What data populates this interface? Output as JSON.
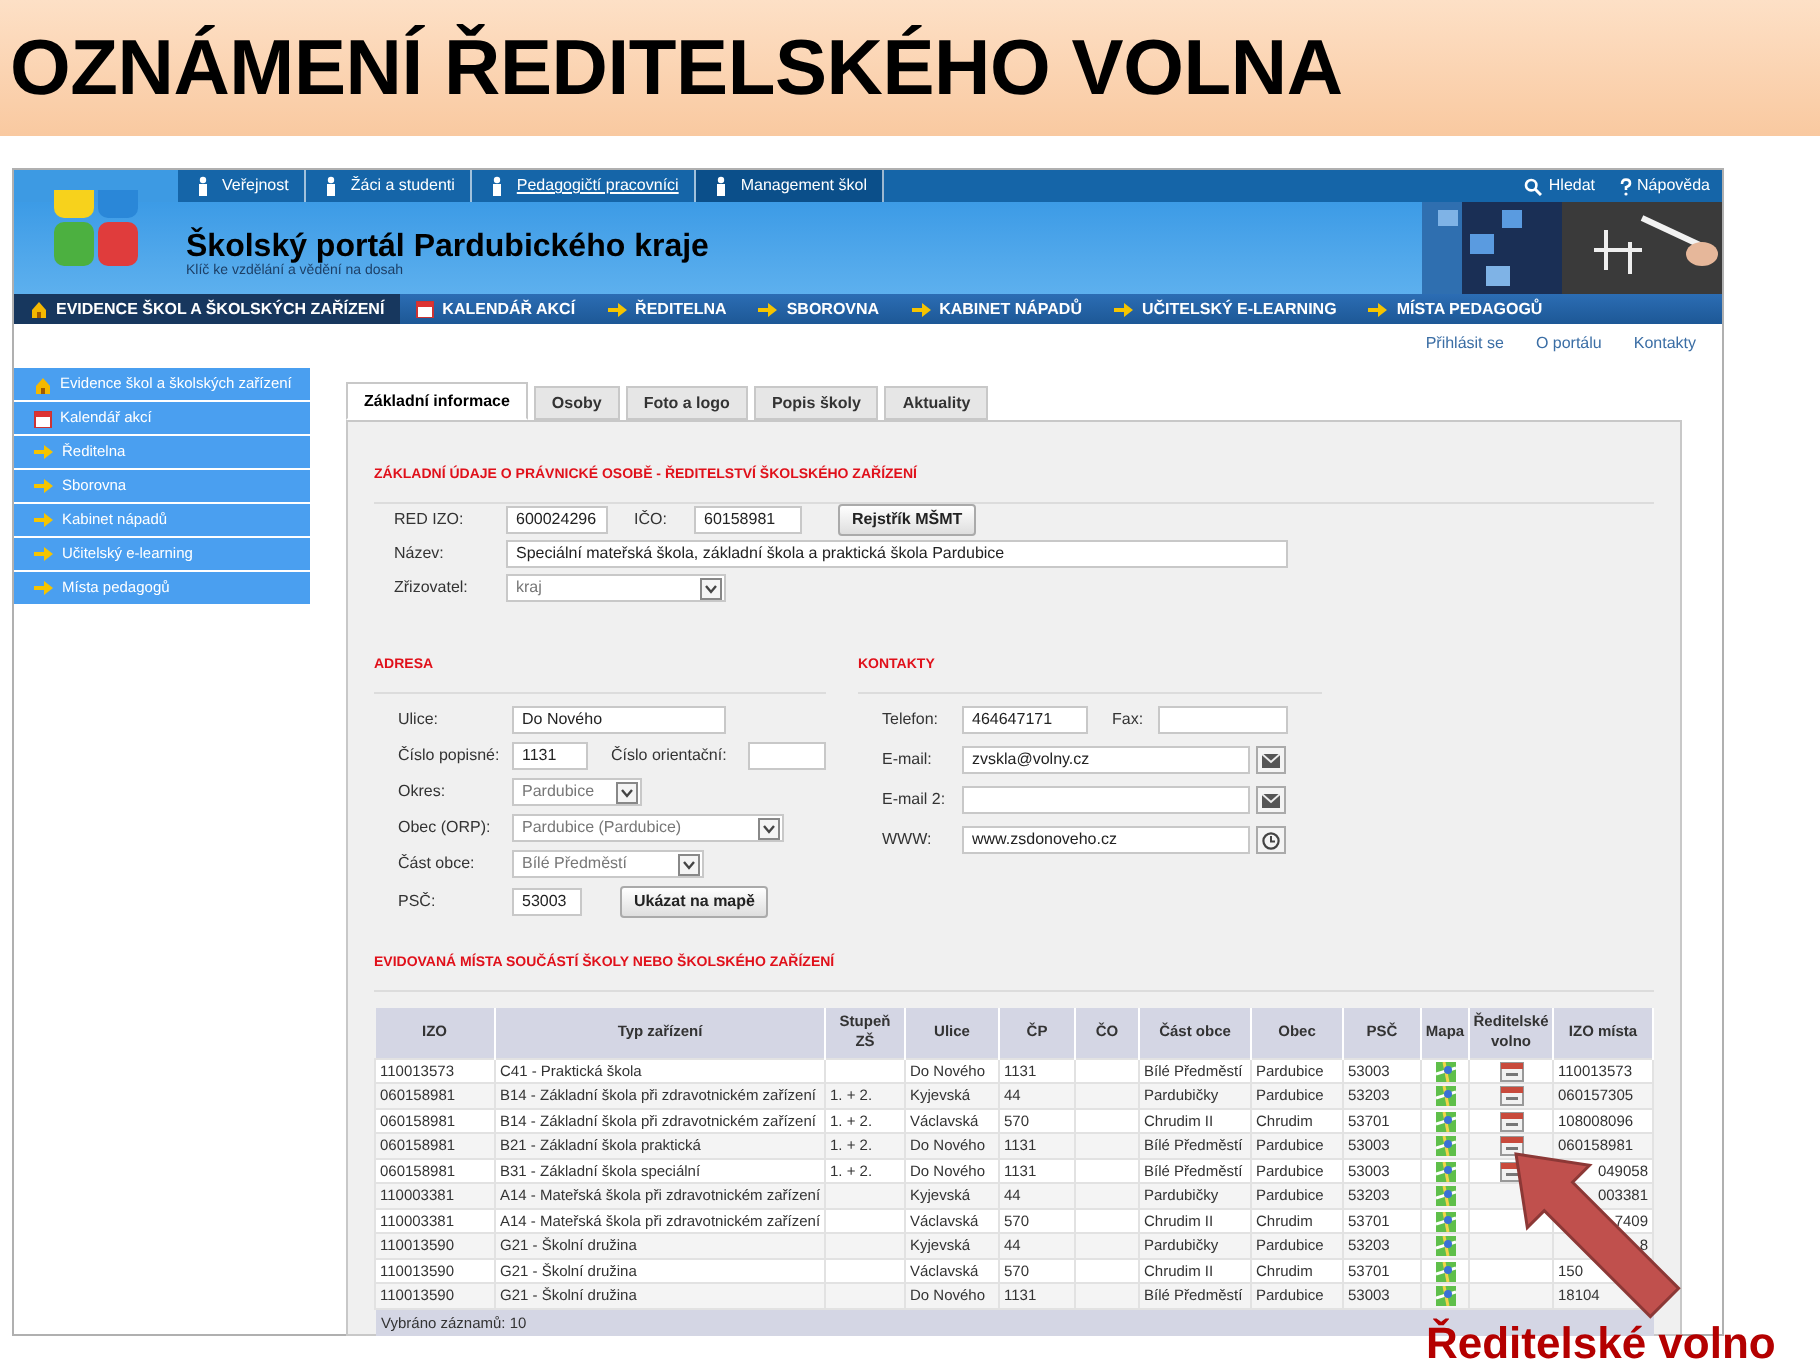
{
  "slide_title": "OZNÁMENÍ ŘEDITELSKÉHO VOLNA",
  "top_nav": [
    {
      "label": "Veřejnost",
      "selected": false,
      "hover": false
    },
    {
      "label": "Žáci a studenti",
      "selected": false,
      "hover": false
    },
    {
      "label": "Pedagogičtí pracovníci",
      "selected": false,
      "hover": true
    },
    {
      "label": "Management škol",
      "selected": true,
      "hover": false
    }
  ],
  "utility_links": [
    {
      "kind": "search",
      "label": "Hledat"
    },
    {
      "kind": "help",
      "label": "Nápověda"
    }
  ],
  "portal_title": "Školský portál Pardubického kraje",
  "portal_subtitle": "Klíč ke vzdělání a vědění na dosah",
  "main_menu": [
    {
      "kind": "home",
      "label": "EVIDENCE ŠKOL A ŠKOLSKÝCH ZAŘÍZENÍ",
      "selected": true
    },
    {
      "kind": "calendar",
      "label": "KALENDÁŘ AKCÍ",
      "selected": false
    },
    {
      "kind": "link",
      "label": "ŘEDITELNA",
      "selected": false
    },
    {
      "kind": "link",
      "label": "SBOROVNA",
      "selected": false
    },
    {
      "kind": "link",
      "label": "KABINET NÁPADŮ",
      "selected": false
    },
    {
      "kind": "link",
      "label": "UČITELSKÝ E-LEARNING",
      "selected": false
    },
    {
      "kind": "link",
      "label": "MÍSTA PEDAGOGŮ",
      "selected": false
    }
  ],
  "header_links": [
    "Přihlásit se",
    "O portálu",
    "Kontakty"
  ],
  "sidebar": [
    {
      "kind": "home",
      "label": "Evidence škol a školských zařízení"
    },
    {
      "kind": "calendar",
      "label": "Kalendář akcí"
    },
    {
      "kind": "link",
      "label": "Ředitelna"
    },
    {
      "kind": "link",
      "label": "Sborovna"
    },
    {
      "kind": "link",
      "label": "Kabinet nápadů"
    },
    {
      "kind": "link",
      "label": "Učitelský e-learning"
    },
    {
      "kind": "link",
      "label": "Místa pedagogů"
    }
  ],
  "tabs": [
    {
      "label": "Základní informace",
      "selected": true
    },
    {
      "label": "Osoby",
      "selected": false
    },
    {
      "label": "Foto a logo",
      "selected": false
    },
    {
      "label": "Popis školy",
      "selected": false
    },
    {
      "label": "Aktuality",
      "selected": false
    }
  ],
  "basic": {
    "heading": "ZÁKLADNÍ ÚDAJE O PRÁVNICKÉ OSOBĚ - ŘEDITELSTVÍ ŠKOLSKÉHO ZAŘÍZENÍ",
    "red_izo": {
      "label": "RED IZO:",
      "value": "600024296"
    },
    "ico": {
      "label": "IČO:",
      "value": "60158981"
    },
    "registry_button": "Rejstřík MŠMT",
    "name": {
      "label": "Název:",
      "value": "Speciální mateřská škola, základní škola a praktická škola Pardubice"
    },
    "founder": {
      "label": "Zřizovatel:",
      "value": "kraj"
    }
  },
  "address": {
    "heading": "ADRESA",
    "street": {
      "label": "Ulice:",
      "value": "Do Nového"
    },
    "number": {
      "label": "Číslo popisné:",
      "value": "1131"
    },
    "orientation": {
      "label": "Číslo orientační:"
    },
    "district": {
      "label": "Okres:",
      "value": "Pardubice"
    },
    "municipality": {
      "label": "Obec (ORP):",
      "value": "Pardubice (Pardubice)"
    },
    "part": {
      "label": "Část obce:",
      "value": "Bílé Předměstí"
    },
    "zip": {
      "label": "PSČ:",
      "value": "53003"
    },
    "map_button": "Ukázat na mapě"
  },
  "contacts": {
    "heading": "KONTAKTY",
    "phone": {
      "label": "Telefon:",
      "value": "464647171"
    },
    "fax": {
      "label": "Fax:"
    },
    "email": {
      "label": "E-mail:",
      "value": "zvskla@volny.cz"
    },
    "email2": {
      "label": "E-mail 2:"
    },
    "web": {
      "label": "WWW:",
      "value": "www.zsdonoveho.cz"
    }
  },
  "places": {
    "heading": "EVIDOVANÁ MÍSTA SOUČÁSTÍ ŠKOLY NEBO ŠKOLSKÉHO ZAŘÍZENÍ",
    "columns": [
      "IZO",
      "Typ zařízení",
      "Stupeň ZŠ",
      "Ulice",
      "ČP",
      "ČO",
      "Část obce",
      "Obec",
      "PSČ",
      "Mapa",
      "Ředitelské volno",
      "IZO místa"
    ],
    "rows": [
      {
        "izo": "110013573",
        "type": "C41 - Praktická škola",
        "street": "Do Nového",
        "cp": "1131",
        "part": "Bílé Předměstí",
        "town": "Pardubice",
        "zip": "53003",
        "leave": true,
        "place_izo": "110013573"
      },
      {
        "izo": "060158981",
        "type": "B14 - Základní škola při zdravotnickém zařízení",
        "level": "1. + 2.",
        "street": "Kyjevská",
        "cp": "44",
        "part": "Pardubičky",
        "town": "Pardubice",
        "zip": "53203",
        "leave": true,
        "place_izo": "060157305"
      },
      {
        "izo": "060158981",
        "type": "B14 - Základní škola při zdravotnickém zařízení",
        "level": "1. + 2.",
        "street": "Václavská",
        "cp": "570",
        "part": "Chrudim II",
        "town": "Chrudim",
        "zip": "53701",
        "leave": true,
        "place_izo": "108008096"
      },
      {
        "izo": "060158981",
        "type": "B21 - Základní škola praktická",
        "level": "1. + 2.",
        "street": "Do Nového",
        "cp": "1131",
        "part": "Bílé Předměstí",
        "town": "Pardubice",
        "zip": "53003",
        "leave": true,
        "place_izo": "060158981"
      },
      {
        "izo": "060158981",
        "type": "B31 - Základní škola speciální",
        "level": "1. + 2.",
        "street": "Do Nového",
        "cp": "1131",
        "part": "Bílé Předměstí",
        "town": "Pardubice",
        "zip": "53003",
        "leave": true,
        "place_izo": "049058",
        "covered_start": true
      },
      {
        "izo": "110003381",
        "type": "A14 - Mateřská škola při zdravotnickém zařízení",
        "street": "Kyjevská",
        "cp": "44",
        "part": "Pardubičky",
        "town": "Pardubice",
        "zip": "53203",
        "leave": false,
        "place_izo": "003381",
        "covered_start": true
      },
      {
        "izo": "110003381",
        "type": "A14 - Mateřská škola při zdravotnickém zařízení",
        "street": "Václavská",
        "cp": "570",
        "part": "Chrudim II",
        "town": "Chrudim",
        "zip": "53701",
        "leave": false,
        "place_izo": "7409",
        "covered_start": true
      },
      {
        "izo": "110013590",
        "type": "G21 - Školní družina",
        "street": "Kyjevská",
        "cp": "44",
        "part": "Pardubičky",
        "town": "Pardubice",
        "zip": "53203",
        "leave": false,
        "place_izo": "8",
        "covered_start": true
      },
      {
        "izo": "110013590",
        "type": "G21 - Školní družina",
        "street": "Václavská",
        "cp": "570",
        "part": "Chrudim II",
        "town": "Chrudim",
        "zip": "53701",
        "leave": false,
        "place_izo": "150",
        "covered_start": false
      },
      {
        "izo": "110013590",
        "type": "G21 - Školní družina",
        "street": "Do Nového",
        "cp": "1131",
        "part": "Bílé Předměstí",
        "town": "Pardubice",
        "zip": "53003",
        "leave": false,
        "place_izo": "18104",
        "covered_start": false
      }
    ],
    "footer": "Vybráno záznamů: 10"
  },
  "callout": "Ředitelské volno"
}
